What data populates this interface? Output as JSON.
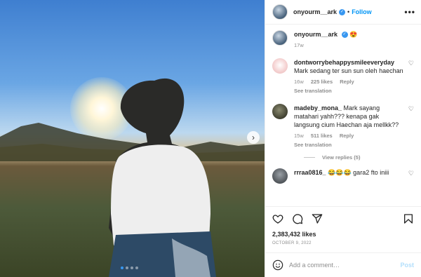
{
  "post": {
    "username": "onyourm__ark",
    "separator": "•",
    "follow_label": "Follow",
    "more_label": "•••",
    "verified_mark": "✓"
  },
  "caption": {
    "username": "onyourm__ark",
    "emoji": "😍",
    "age": "17w"
  },
  "comments": [
    {
      "username": "dontworrybehappysmileeveryday",
      "text": "Mark sedang ter sun sun oleh haechan",
      "age": "16w",
      "likes": "225 likes",
      "reply": "Reply",
      "translation": "See translation"
    },
    {
      "username": "madeby_mona_",
      "text": "Mark sayang matahari yahh??? kenapa gak langsung cium Haechan aja mellkk??",
      "age": "15w",
      "likes": "511 likes",
      "reply": "Reply",
      "translation": "See translation",
      "view_replies": "View replies (5)"
    },
    {
      "username": "rrraa0816_",
      "text": "😂😂😂 gara2 fto iniii"
    }
  ],
  "likes": "2,383,432 likes",
  "date": "OCTOBER 9, 2022",
  "add_comment": {
    "emoji": "☺",
    "placeholder": "Add a comment…",
    "post_label": "Post"
  },
  "carousel": {
    "next_label": "›",
    "slide_count": 4,
    "active_slide": 1
  },
  "icons": {
    "like": "heart-icon",
    "comment": "comment-icon",
    "share": "share-icon",
    "save": "bookmark-icon"
  },
  "colors": {
    "follow": "#0095f6",
    "verified": "#3897f0",
    "post_disabled": "#b2dffc"
  }
}
